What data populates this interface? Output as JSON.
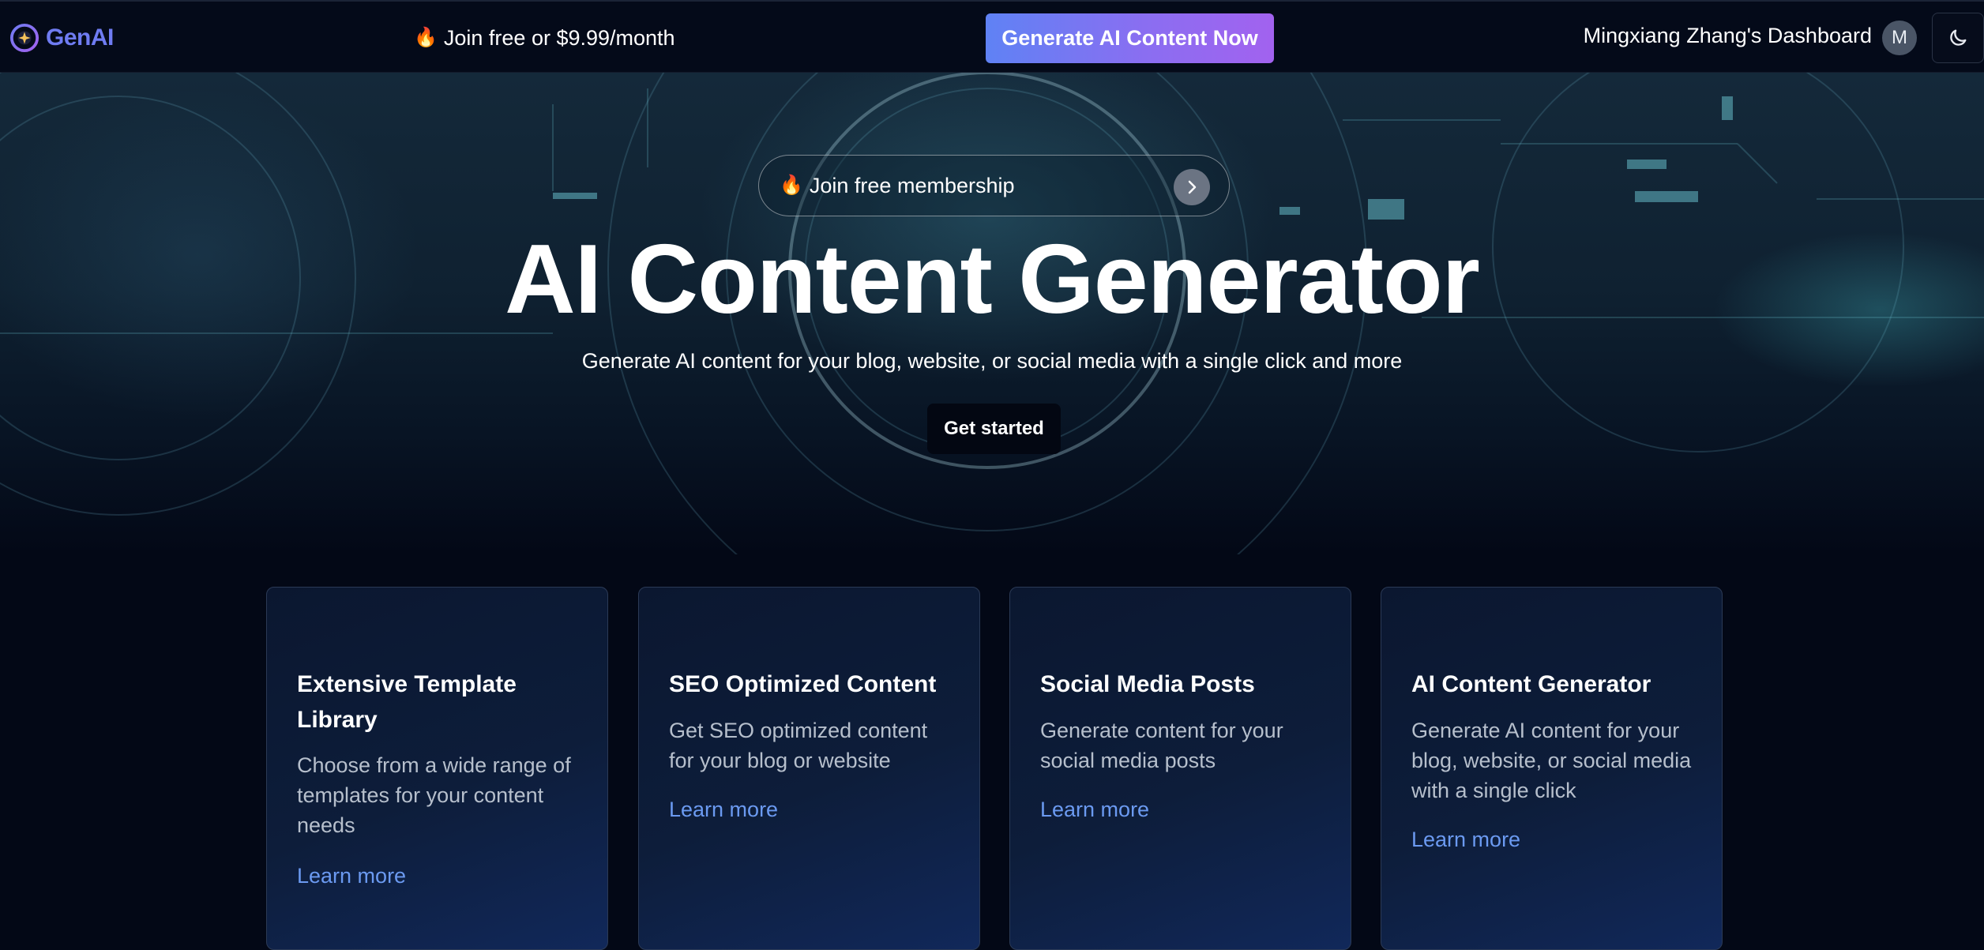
{
  "header": {
    "logo_text": "GenAI",
    "promo_text": "Join free or $9.99/month",
    "cta_label": "Generate AI Content Now",
    "dashboard_label": "Mingxiang Zhang's Dashboard",
    "avatar_initial": "M",
    "theme_toggle_icon": "moon-icon"
  },
  "hero": {
    "membership_label": "Join free membership",
    "title": "AI Content Generator",
    "subtitle": "Generate AI content for your blog, website, or social media with a single click and more",
    "get_started_label": "Get started"
  },
  "features": [
    {
      "title": "Extensive Template Library",
      "description": "Choose from a wide range of templates for your content needs",
      "link": "Learn more"
    },
    {
      "title": "SEO Optimized Content",
      "description": "Get SEO optimized content for your blog or website",
      "link": "Learn more"
    },
    {
      "title": "Social Media Posts",
      "description": "Generate content for your social media posts",
      "link": "Learn more"
    },
    {
      "title": "AI Content Generator",
      "description": "Generate AI content for your blog, website, or social media with a single click",
      "link": "Learn more"
    }
  ],
  "colors": {
    "background": "#030816",
    "brand": "#6f7cf2",
    "cta_gradient_start": "#5f82f4",
    "cta_gradient_end": "#a262ef",
    "link": "#6b9af1"
  }
}
